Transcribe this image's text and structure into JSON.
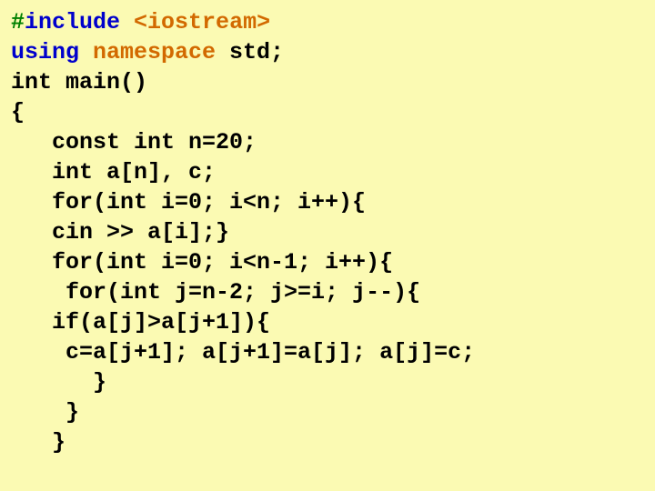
{
  "code": {
    "l1_hash": "#",
    "l1_include": "include ",
    "l1_iostream": "<iostream>",
    "l2_using": "using ",
    "l2_namespace": "namespace ",
    "l2_std": "std;",
    "l3": "int main()",
    "l4": "{",
    "l5": "   const int n=20;",
    "l6": "   int a[n], c;",
    "l7": "   for(int i=0; i<n; i++){",
    "l8": "   cin >> a[i];}",
    "l9": "   for(int i=0; i<n-1; i++){",
    "l10": "    for(int j=n-2; j>=i; j--){",
    "l11": "   if(a[j]>a[j+1]){",
    "l12": "    c=a[j+1]; a[j+1]=a[j]; a[j]=c;",
    "l13": "      }",
    "l14": "    }",
    "l15": "   }"
  }
}
